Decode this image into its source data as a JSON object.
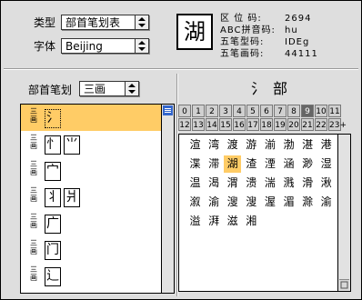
{
  "top": {
    "type_label": "类型",
    "type_value": "部首笔划表",
    "font_label": "字体",
    "font_value": "Beijing"
  },
  "preview": {
    "char": "湖",
    "info": [
      {
        "label": "区 位 码:",
        "value": "2694"
      },
      {
        "label": "ABC拼音码:",
        "value": "hu"
      },
      {
        "label": "五笔型码:",
        "value": "IDEg"
      },
      {
        "label": "五笔画码:",
        "value": "44111"
      }
    ]
  },
  "left": {
    "stroke_label": "部首笔划",
    "stroke_value": "三画",
    "rows": [
      {
        "label": "三画",
        "chars": [
          "氵"
        ],
        "selected": true
      },
      {
        "label": "三画",
        "chars": [
          "忄",
          "⺌"
        ],
        "selected": false
      },
      {
        "label": "三画",
        "chars": [
          "宀"
        ],
        "selected": false
      },
      {
        "label": "三画",
        "chars": [
          "丬",
          "爿"
        ],
        "selected": false
      },
      {
        "label": "三画",
        "chars": [
          "广"
        ],
        "selected": false
      },
      {
        "label": "三画",
        "chars": [
          "门"
        ],
        "selected": false
      },
      {
        "label": "三画",
        "chars": [
          "辶"
        ],
        "selected": false
      }
    ]
  },
  "right": {
    "radical_title": "氵部",
    "tabs_row1": [
      "0",
      "1",
      "2",
      "3",
      "4",
      "5",
      "6",
      "7",
      "8",
      "9",
      "10",
      "11"
    ],
    "tabs_row2": [
      "12",
      "13",
      "14",
      "15",
      "16",
      "17",
      "18",
      "19",
      "20",
      "21",
      "22",
      "23+"
    ],
    "active_tab": "9",
    "chars": [
      "渲",
      "湾",
      "渡",
      "游",
      "湔",
      "渤",
      "湛",
      "港",
      "渫",
      "滞",
      "湖",
      "渣",
      "湮",
      "涵",
      "渺",
      "湿",
      "温",
      "渴",
      "渭",
      "溃",
      "湍",
      "溅",
      "滑",
      "湫",
      "溆",
      "渝",
      "溲",
      "溲",
      "渥",
      "湄",
      "滁",
      "渝",
      "溢",
      "湃",
      "滋",
      "湘"
    ],
    "selected_char": "湖",
    "muted_color": "#a8a8a8",
    "highlight_color": "#ffcc66"
  }
}
